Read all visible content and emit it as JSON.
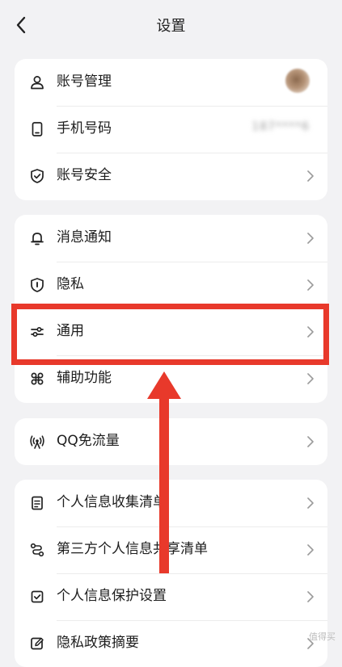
{
  "header": {
    "title": "设置"
  },
  "group1": [
    {
      "label": "账号管理",
      "icon": "person-icon"
    },
    {
      "label": "手机号码",
      "icon": "phone-icon",
      "value": "187****6"
    },
    {
      "label": "账号安全",
      "icon": "shield-check-icon"
    }
  ],
  "group2": [
    {
      "label": "消息通知",
      "icon": "bell-icon"
    },
    {
      "label": "隐私",
      "icon": "shield-icon"
    },
    {
      "label": "通用",
      "icon": "sliders-icon"
    },
    {
      "label": "辅助功能",
      "icon": "command-icon"
    }
  ],
  "group3": [
    {
      "label": "QQ免流量",
      "icon": "signal-icon"
    }
  ],
  "group4": [
    {
      "label": "个人信息收集清单",
      "icon": "document-icon"
    },
    {
      "label": "第三方个人信息共享清单",
      "icon": "share-icon"
    },
    {
      "label": "个人信息保护设置",
      "icon": "checkbox-icon"
    },
    {
      "label": "隐私政策摘要",
      "icon": "edit-icon"
    }
  ],
  "annotation": {
    "highlight_color": "#e8392b"
  },
  "watermark": "值得买"
}
